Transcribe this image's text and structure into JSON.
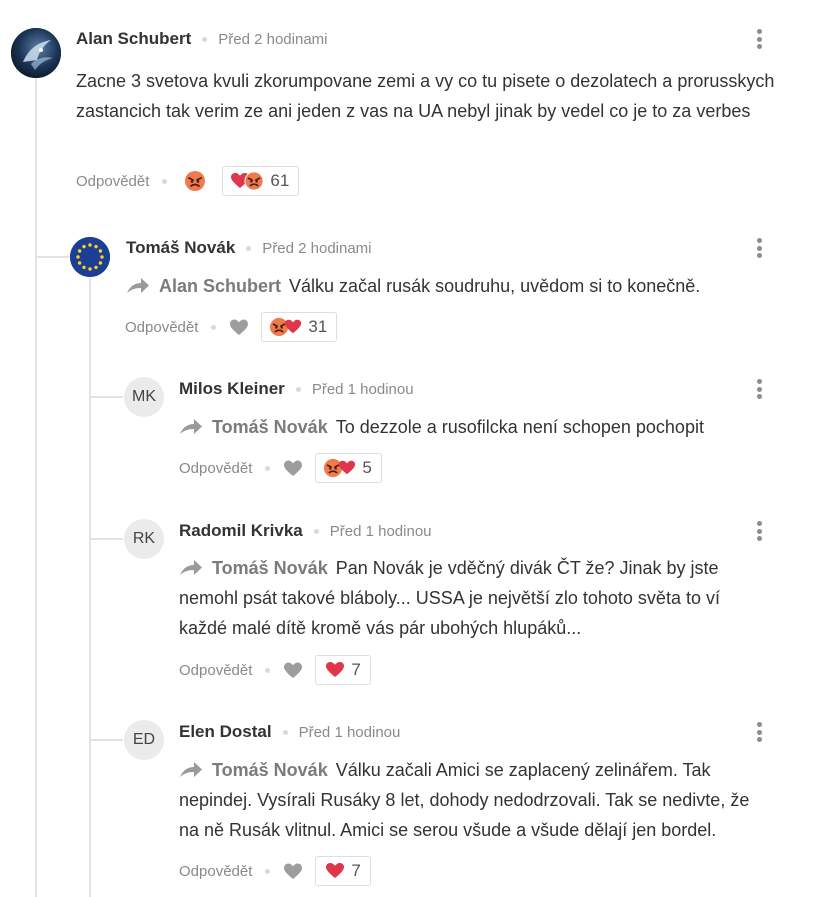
{
  "reply_label": "Odpovědět",
  "colors": {
    "line": "#e2e2e2",
    "heart_red": "#e0354a",
    "angry_face": "#ef7a4c"
  },
  "comments": [
    {
      "author": "Alan Schubert",
      "time": "Před 2 hodinami",
      "avatar": {
        "type": "image",
        "icon": "dark-bird-photo"
      },
      "text": "Zacne 3 svetova kvuli zkorumpovane zemi a vy co tu pisete o dezolatech a prorusskych zastancich tak verim ze ani jeden z vas na UA nebyl jinak by vedel co je to za verbes",
      "reaction_count": "61"
    },
    {
      "author": "Tomáš Novák",
      "time": "Před 2 hodinami",
      "avatar": {
        "type": "image",
        "icon": "eu-flag-icon"
      },
      "reply_to": "Alan Schubert",
      "text": "Válku začal rusák soudruhu, uvědom si to konečně.",
      "reaction_count": "31"
    },
    {
      "author": "Milos Kleiner",
      "time": "Před 1 hodinou",
      "avatar": {
        "type": "initials",
        "initials": "MK"
      },
      "reply_to": "Tomáš Novák",
      "text": "To dezzole a rusofilcka není schopen pochopit",
      "reaction_count": "5"
    },
    {
      "author": "Radomil Krivka",
      "time": "Před 1 hodinou",
      "avatar": {
        "type": "initials",
        "initials": "RK"
      },
      "reply_to": "Tomáš Novák",
      "text": "Pan Novák je vděčný divák ČT že? Jinak by jste nemohl psát takové bláboly... USSA je největší zlo tohoto světa to ví každé malé dítě kromě vás pár ubohých hlupáků...",
      "reaction_count": "7"
    },
    {
      "author": "Elen Dostal",
      "time": "Před 1 hodinou",
      "avatar": {
        "type": "initials",
        "initials": "ED"
      },
      "reply_to": "Tomáš Novák",
      "text": "Válku začali Amici se zaplacený zelinářem. Tak nepindej. Vysírali Rusáky 8 let, dohody nedodrzovali. Tak se nedivte, že na ně Rusák vlitnul. Amici se serou všude a všude dělají jen bordel.",
      "reaction_count": "7"
    }
  ]
}
